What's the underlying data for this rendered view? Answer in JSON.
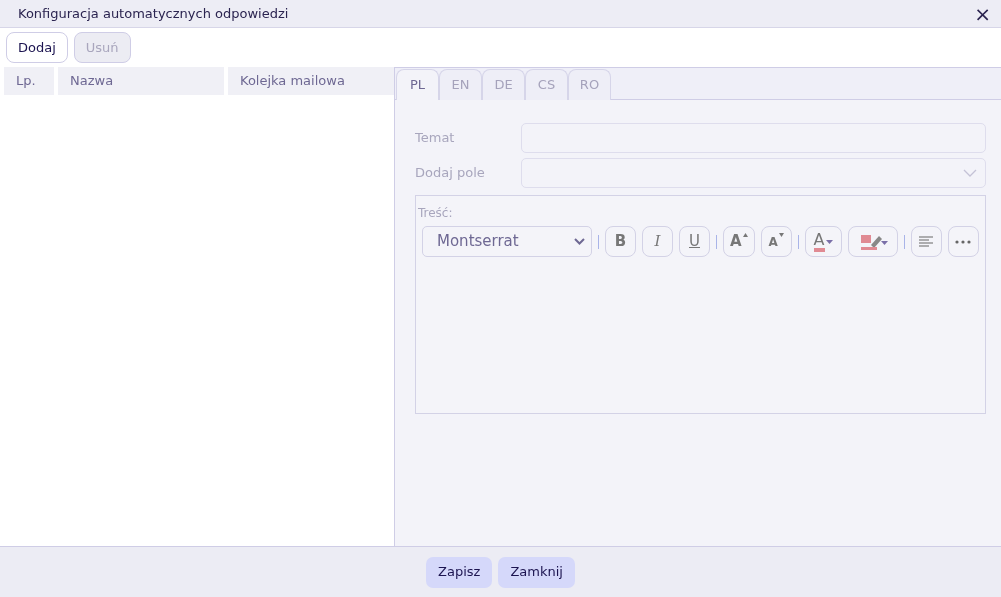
{
  "window": {
    "title": "Konfiguracja automatycznych odpowiedzi",
    "close": "×"
  },
  "toolbar": [
    {
      "label": "Dodaj",
      "disabled": false
    },
    {
      "label": "Usuń",
      "disabled": true
    }
  ],
  "table": {
    "columns": [
      "Lp.",
      "Nazwa",
      "Kolejka mailowa"
    ]
  },
  "tabs": [
    {
      "label": "PL",
      "selected": true
    },
    {
      "label": "EN",
      "selected": false
    },
    {
      "label": "DE",
      "selected": false
    },
    {
      "label": "CS",
      "selected": false
    },
    {
      "label": "RO",
      "selected": false
    }
  ],
  "form": {
    "disabled": true,
    "subject_label": "Temat",
    "field_label": "Dodaj pole",
    "content_label": "Treść:"
  },
  "editor_toolbar": [
    {
      "kind": "font",
      "label": "Montserrat"
    },
    {
      "kind": "sep"
    },
    {
      "kind": "bold",
      "label": "B"
    },
    {
      "kind": "italic",
      "label": "I"
    },
    {
      "kind": "underline",
      "label": "U"
    },
    {
      "kind": "sep"
    },
    {
      "kind": "grow",
      "label": "A"
    },
    {
      "kind": "shrink",
      "label": "A"
    },
    {
      "kind": "sep"
    },
    {
      "kind": "color",
      "label": "A"
    },
    {
      "kind": "highlight"
    },
    {
      "kind": "sep"
    },
    {
      "kind": "align"
    },
    {
      "kind": "more"
    }
  ],
  "footer": [
    "Zapisz",
    "Zamknij"
  ]
}
